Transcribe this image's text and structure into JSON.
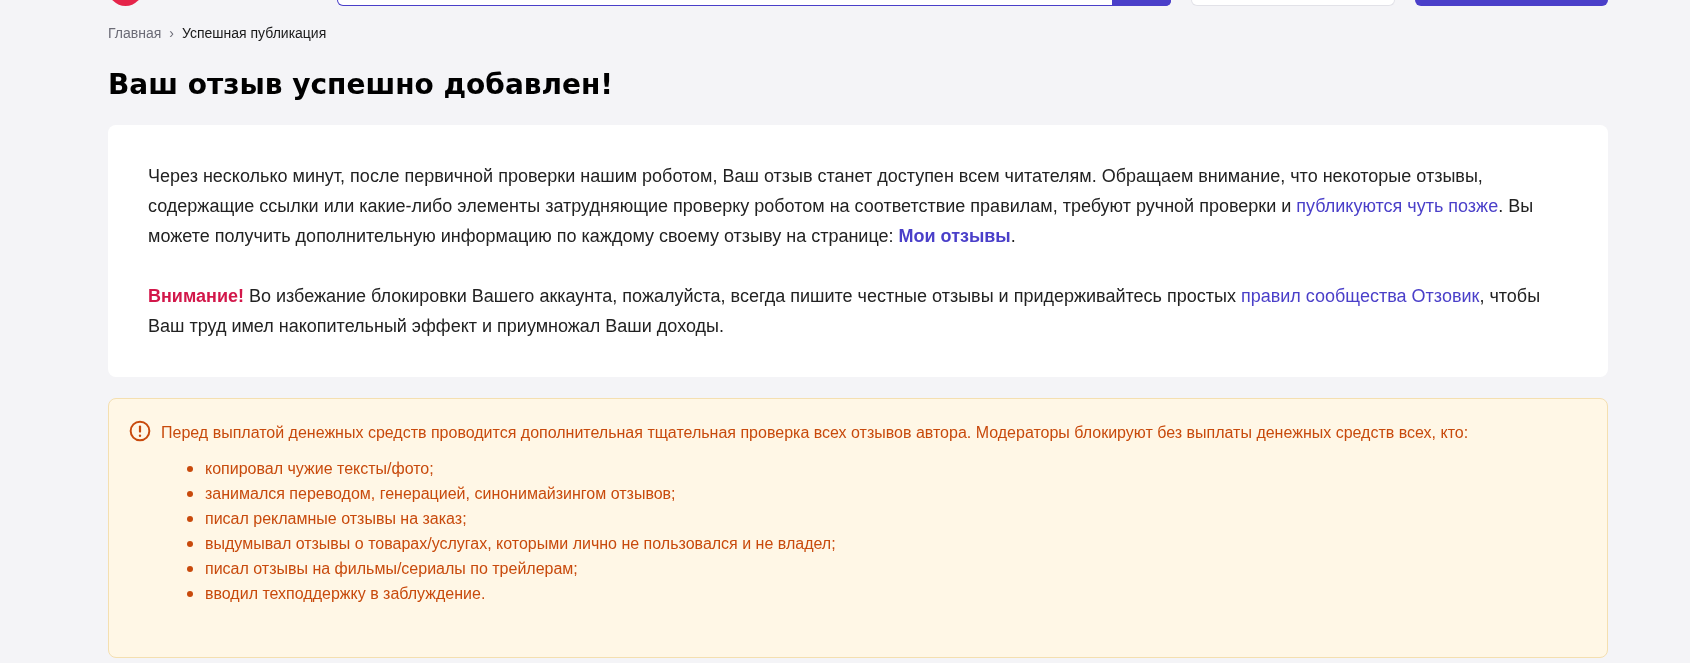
{
  "breadcrumbs": [
    {
      "label": "Главная",
      "kind": "link"
    },
    {
      "label": "Успешная публикация",
      "kind": "current"
    }
  ],
  "breadcrumb_separator": "›",
  "title": "Ваш отзыв успешно добавлен!",
  "notice_card": {
    "paragraphs": [
      [
        {
          "kind": "text",
          "text": "Через несколько минут, после первичной проверки нашим роботом, Ваш отзыв станет доступен всем читателям. Обращаем внимание, что некоторые отзывы, содержащие ссылки или какие-либо элементы затрудняющие проверку роботом на соответствие правилам, требуют ручной проверки и "
        },
        {
          "kind": "link",
          "text": "публикуются чуть позже"
        },
        {
          "kind": "text",
          "text": ". Вы можете получить дополнительную информацию по каждому своему отзыву на странице: "
        },
        {
          "kind": "strong_link",
          "text": "Мои отзывы"
        },
        {
          "kind": "text",
          "text": "."
        }
      ],
      [
        {
          "kind": "alert",
          "text": "Внимание!"
        },
        {
          "kind": "text",
          "text": " Во избежание блокировки Вашего аккаунта, пожалуйста, всегда пишите честные отзывы и придерживайтесь простых "
        },
        {
          "kind": "link",
          "text": "правил сообщества Отзовик"
        },
        {
          "kind": "text",
          "text": ", чтобы Ваш труд имел накопительный эффект и приумножал Ваши доходы."
        }
      ]
    ]
  },
  "warning_box": {
    "intro": "Перед выплатой денежных средств проводится дополнительная тщательная проверка всех отзывов автора. Модераторы блокируют без выплаты денежных средств всех, кто:",
    "items": [
      "копировал чужие тексты/фото;",
      "занимался переводом, генерацией, синонимайзингом отзывов;",
      "писал рекламные отзывы на заказ;",
      "выдумывал отзывы о товарах/услугах, которыми лично не пользовался и не владел;",
      "писал отзывы на фильмы/сериалы по трейлерам;",
      "вводил техподдержку в заблуждение."
    ]
  }
}
